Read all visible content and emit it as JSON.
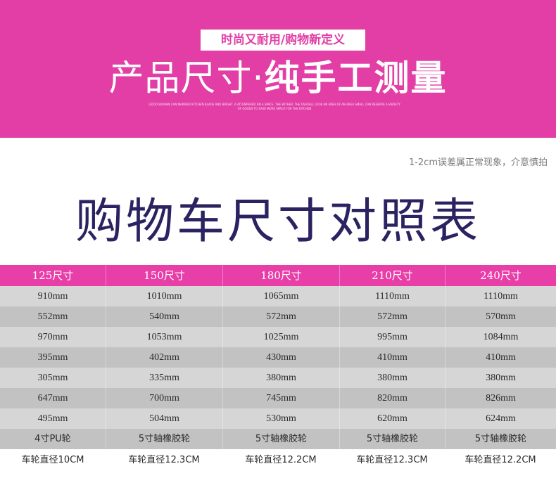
{
  "banner": {
    "tag": "时尚又耐用/购物新定义",
    "title_normal": "产品尺寸·",
    "title_bold": "纯手工测量",
    "fine_print": "GOOD WOMAN CAN MARRIED KITCHEN BLADE AND BRIGHT. A ATTEMPERED AN A SPACE. THE WITHER. THE OVERALL LOOK AN AREA OF AN AREA SMALL CAN RESERVE A VARIETY OF GOODS TO SAVE MORE SPACE FOR THE KITCHEN"
  },
  "note": "1-2cm误差属正常现象，介意慎拍",
  "title": "购物车尺寸对照表",
  "table": {
    "headers": [
      "125尺寸",
      "150尺寸",
      "180尺寸",
      "210尺寸",
      "240尺寸"
    ],
    "rows": [
      [
        "910mm",
        "1010mm",
        "1065mm",
        "1110mm",
        "1110mm"
      ],
      [
        "552mm",
        "540mm",
        "572mm",
        "572mm",
        "570mm"
      ],
      [
        "970mm",
        "1053mm",
        "1025mm",
        "995mm",
        "1084mm"
      ],
      [
        "395mm",
        "402mm",
        "430mm",
        "410mm",
        "410mm"
      ],
      [
        "305mm",
        "335mm",
        "380mm",
        "380mm",
        "380mm"
      ],
      [
        "647mm",
        "700mm",
        "745mm",
        "820mm",
        "826mm"
      ],
      [
        "495mm",
        "504mm",
        "530mm",
        "620mm",
        "624mm"
      ],
      [
        "4寸PU轮",
        "5寸轴橡胶轮",
        "5寸轴橡胶轮",
        "5寸轴橡胶轮",
        "5寸轴橡胶轮"
      ],
      [
        "车轮直径10CM",
        "车轮直径12.3CM",
        "车轮直径12.2CM",
        "车轮直径12.3CM",
        "车轮直径12.2CM"
      ]
    ]
  },
  "colors": {
    "banner": "#e23ea6",
    "header": "#e83ea8",
    "title": "#2b2361"
  }
}
